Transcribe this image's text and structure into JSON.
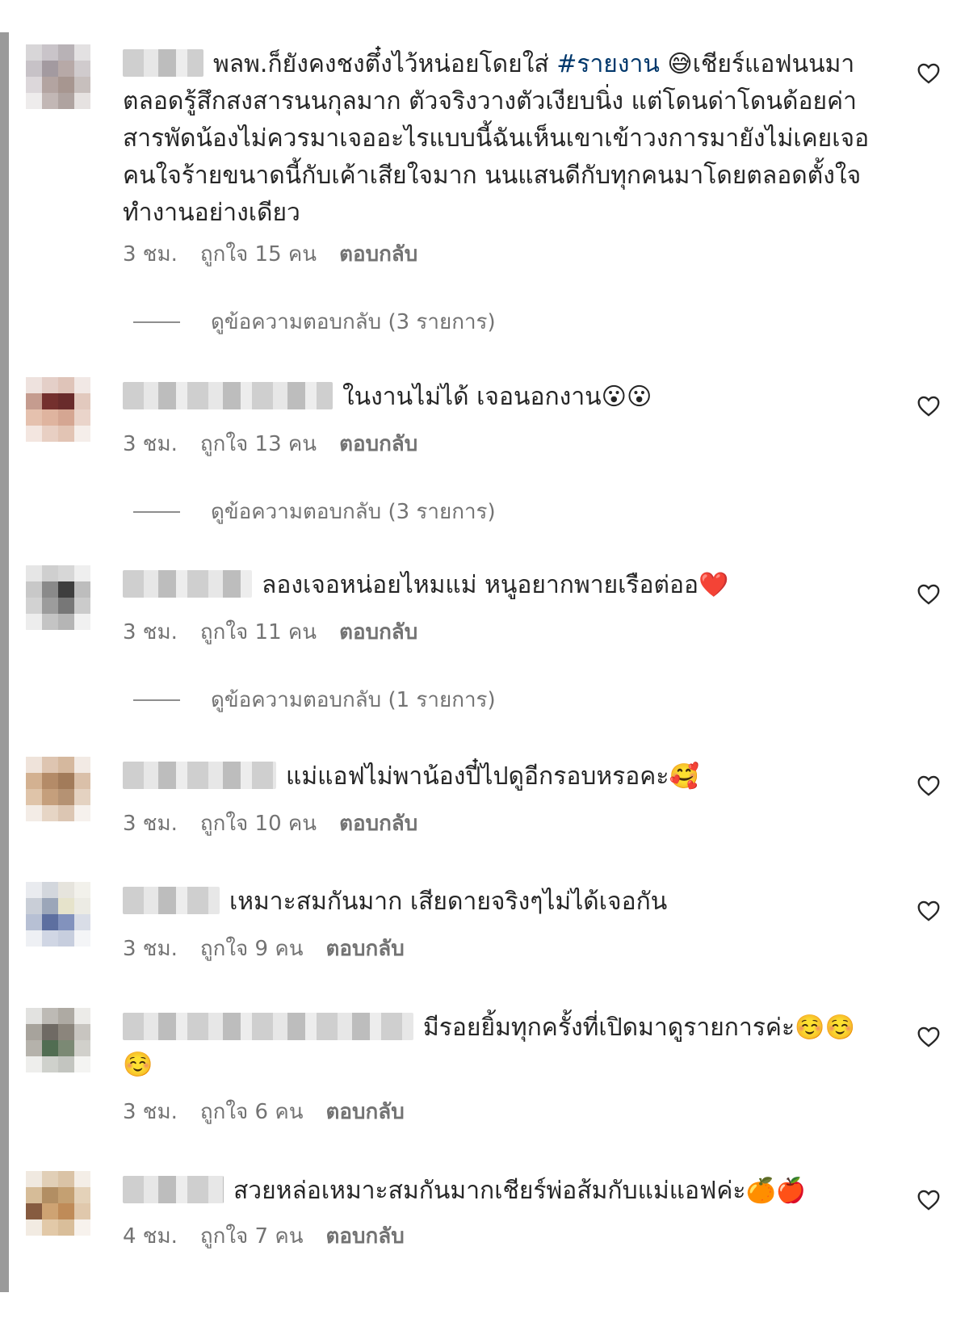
{
  "colors": {
    "meta_text": "#737373",
    "hashtag": "#00376b",
    "body_text": "#262626"
  },
  "icons": {
    "like": "heart-outline-icon"
  },
  "comments": [
    {
      "text_before": "พลพ.ก็ยังคงชงตึ๋งไว้หน่อยโดยใส่ ",
      "hashtag": "#รายงาน",
      "text_after": " 😅เชียร์แอฟนนมาตลอดรู้สึกสงสารนนกุลมาก ตัวจริงวางตัวเงียบนิ่ง แต่โดนด่าโดนด้อยค่าสารพัดน้องไม่ควรมาเจออะไรแบบนี้ฉันเห็นเขาเข้าวงการมายังไม่เคยเจอคนใจร้ายขนาดนี้กับเค้าเสียใจมาก นนแสนดีกับทุกคนมาโดยตลอดตั้งใจทำงานอย่างเดียว",
      "time": "3 ชม.",
      "likes": "ถูกใจ 15 คน",
      "reply": "ตอบกลับ",
      "view_replies": "ดูข้อความตอบกลับ (3 รายการ)"
    },
    {
      "text": "ในงานไม่ได้ เจอนอกงาน😮😮",
      "time": "3 ชม.",
      "likes": "ถูกใจ 13 คน",
      "reply": "ตอบกลับ",
      "view_replies": "ดูข้อความตอบกลับ (3 รายการ)"
    },
    {
      "text": "ลองเจอหน่อยไหมแม่ หนูอยากพายเรือต่ออ❤️",
      "time": "3 ชม.",
      "likes": "ถูกใจ 11 คน",
      "reply": "ตอบกลับ",
      "view_replies": "ดูข้อความตอบกลับ (1 รายการ)"
    },
    {
      "text": "แม่แอฟไม่พาน้องปี๋ไปดูอีกรอบหรอคะ🥰",
      "time": "3 ชม.",
      "likes": "ถูกใจ 10 คน",
      "reply": "ตอบกลับ"
    },
    {
      "text": "เหมาะสมกันมาก เสียดายจริงๆไม่ได้เจอกัน",
      "time": "3 ชม.",
      "likes": "ถูกใจ 9 คน",
      "reply": "ตอบกลับ"
    },
    {
      "text": "มีรอยยิ้มทุกครั้งที่เปิดมาดูรายการค่ะ☺️☺️☺️",
      "time": "3 ชม.",
      "likes": "ถูกใจ 6 คน",
      "reply": "ตอบกลับ"
    },
    {
      "text": "สวยหล่อเหมาะสมกันมากเชียร์พ่อส้มกับแม่แอฟค่ะ🍊🍎",
      "time": "4 ชม.",
      "likes": "ถูกใจ 7 คน",
      "reply": "ตอบกลับ"
    }
  ]
}
